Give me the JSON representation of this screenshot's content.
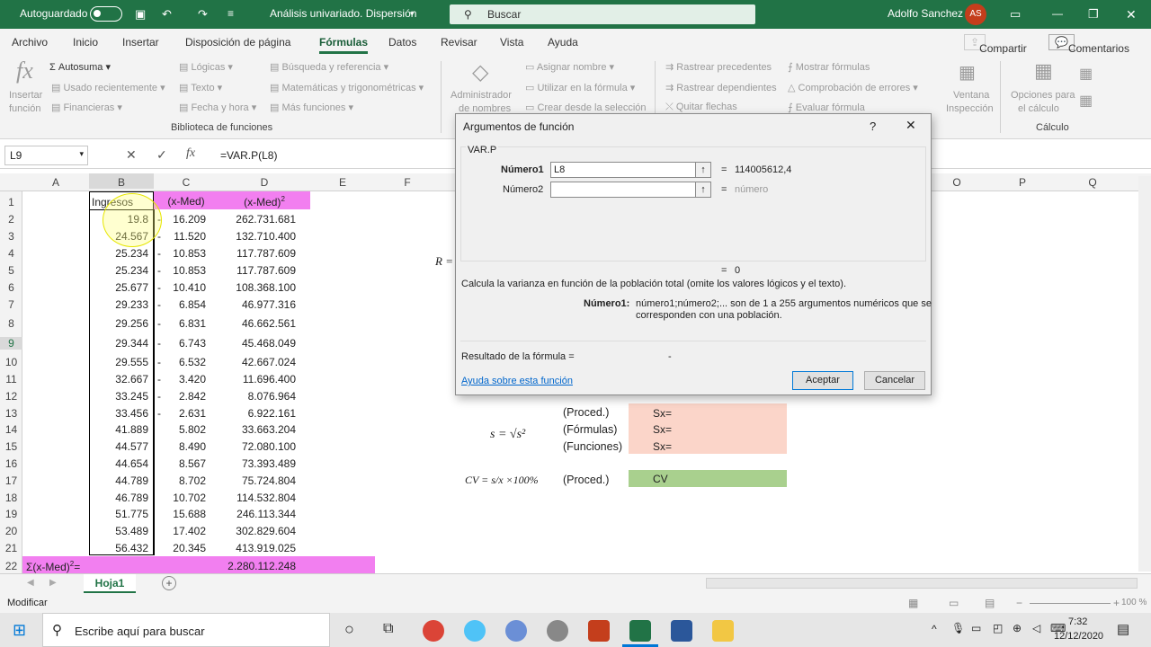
{
  "title_bar": {
    "autosave": "Autoguardado",
    "doc_title": "Análisis univariado. Dispersión",
    "search_placeholder": "Buscar",
    "user": "Adolfo Sanchez",
    "initials": "AS"
  },
  "tabs": [
    "Archivo",
    "Inicio",
    "Insertar",
    "Disposición de página",
    "Fórmulas",
    "Datos",
    "Revisar",
    "Vista",
    "Ayuda"
  ],
  "share": {
    "compartir": "Compartir",
    "comentarios": "Comentarios"
  },
  "ribbon": {
    "insert_function": [
      "Insertar",
      "función"
    ],
    "autosuma": "Autosuma",
    "usado": "Usado recientemente",
    "financieras": "Financieras",
    "logicas": "Lógicas",
    "texto": "Texto",
    "fecha": "Fecha y hora",
    "busqueda": "Búsqueda y referencia",
    "matematicas": "Matemáticas y trigonométricas",
    "mas": "Más funciones",
    "group_lib": "Biblioteca de funciones",
    "admin": [
      "Administrador",
      "de nombres"
    ],
    "asignar": "Asignar nombre",
    "utilizar": "Utilizar en la fórmula",
    "crear": "Crear desde la selección",
    "rastrear_prec": "Rastrear precedentes",
    "rastrear_dep": "Rastrear dependientes",
    "quitar": "Quitar flechas",
    "mostrar": "Mostrar fórmulas",
    "comprobacion": "Comprobación de errores",
    "evaluar": "Evaluar fórmula",
    "ventana": [
      "Ventana",
      "Inspección"
    ],
    "opciones": [
      "Opciones para",
      "el cálculo"
    ],
    "group_calc": "Cálculo"
  },
  "formula_bar": {
    "name_box": "L9",
    "formula": "=VAR.P(L8)"
  },
  "columns": [
    "A",
    "B",
    "C",
    "D",
    "E",
    "F",
    "O",
    "P",
    "Q"
  ],
  "rows": [
    "1",
    "2",
    "3",
    "4",
    "5",
    "6",
    "7",
    "8",
    "9",
    "10",
    "11",
    "12",
    "13",
    "14",
    "15",
    "16",
    "17",
    "18",
    "19",
    "20",
    "21",
    "22"
  ],
  "header_row": {
    "b": "Ingresos",
    "c": "(x-Med)",
    "d": "(x-Med)",
    "sup": "2"
  },
  "data": [
    {
      "b": "19.8",
      "c": "16.209",
      "d": "262.731.681"
    },
    {
      "b": "24.567",
      "c": "11.520",
      "d": "132.710.400"
    },
    {
      "b": "25.234",
      "c": "10.853",
      "d": "117.787.609"
    },
    {
      "b": "25.234",
      "c": "10.853",
      "d": "117.787.609"
    },
    {
      "b": "25.677",
      "c": "10.410",
      "d": "108.368.100"
    },
    {
      "b": "29.233",
      "c": "6.854",
      "d": "46.977.316"
    },
    {
      "b": "29.256",
      "c": "6.831",
      "d": "46.662.561"
    },
    {
      "b": "29.344",
      "c": "6.743",
      "d": "45.468.049"
    },
    {
      "b": "29.555",
      "c": "6.532",
      "d": "42.667.024"
    },
    {
      "b": "32.667",
      "c": "3.420",
      "d": "11.696.400"
    },
    {
      "b": "33.245",
      "c": "2.842",
      "d": "8.076.964"
    },
    {
      "b": "33.456",
      "c": "2.631",
      "d": "6.922.161"
    },
    {
      "b": "41.889",
      "c": "5.802",
      "d": "33.663.204"
    },
    {
      "b": "44.577",
      "c": "8.490",
      "d": "72.080.100"
    },
    {
      "b": "44.654",
      "c": "8.567",
      "d": "73.393.489"
    },
    {
      "b": "44.789",
      "c": "8.702",
      "d": "75.724.804"
    },
    {
      "b": "46.789",
      "c": "10.702",
      "d": "114.532.804"
    },
    {
      "b": "51.775",
      "c": "15.688",
      "d": "246.113.344"
    },
    {
      "b": "53.489",
      "c": "17.402",
      "d": "302.829.604"
    },
    {
      "b": "56.432",
      "c": "20.345",
      "d": "413.919.025"
    }
  ],
  "sum_row": {
    "label": "Σ(x-Med)",
    "sup": "2",
    "eq": "=",
    "value": "2.280.112.248"
  },
  "side": {
    "r_label": "R =",
    "s_formula": "s = √s²",
    "proced": "(Proced.)",
    "formulas": "(Fórmulas)",
    "funciones": "(Funciones)",
    "sx": "Sx=",
    "cv_formula": "CV = s/x ×100%",
    "cv": "CV"
  },
  "dialog": {
    "title": "Argumentos de función",
    "help": "?",
    "func": "VAR.P",
    "n1_label": "Número1",
    "n1_value": "L8",
    "n1_result": "114005612,4",
    "n2_label": "Número2",
    "n2_result": "número",
    "eq": "=",
    "total": "0",
    "desc": "Calcula la varianza en función de la población total (omite los valores lógicos y el texto).",
    "arg_label": "Número1:",
    "arg_desc1": "número1;número2;... son de 1 a 255 argumentos numéricos que se",
    "arg_desc2": "corresponden con una población.",
    "result_label": "Resultado de la fórmula =",
    "result_value": "-",
    "help_link": "Ayuda sobre esta función",
    "ok": "Aceptar",
    "cancel": "Cancelar"
  },
  "sheet_tab": "Hoja1",
  "status": "Modificar",
  "zoom": "100 %",
  "taskbar": {
    "search": "Escribe aquí para buscar",
    "time": "7:32",
    "date": "12/12/2020"
  }
}
